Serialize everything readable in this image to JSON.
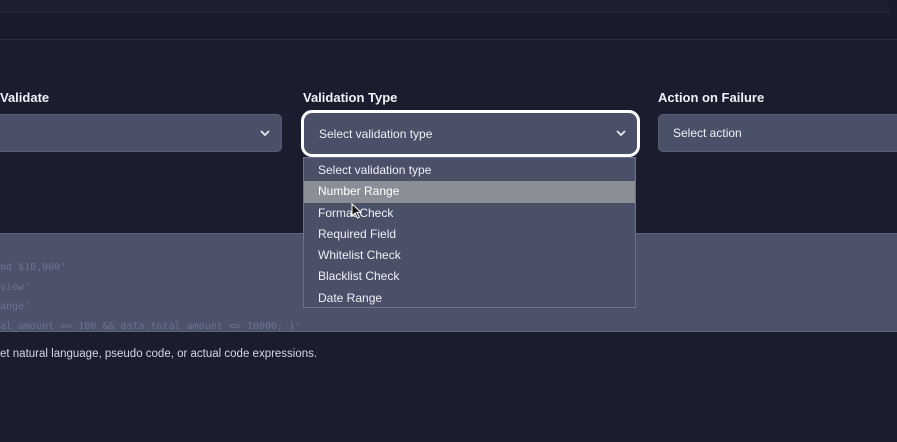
{
  "fields": {
    "field_to_validate": {
      "label": "Validate",
      "value": ""
    },
    "validation_type": {
      "label": "Validation Type",
      "value": "Select validation type"
    },
    "action_on_failure": {
      "label": "Action on Failure",
      "value": "Select action"
    }
  },
  "dropdown": {
    "options": [
      "Select validation type",
      "Number Range",
      "Format Check",
      "Required Field",
      "Whitelist Check",
      "Blacklist Check",
      "Date Range"
    ],
    "hovered": "Number Range"
  },
  "editor": {
    "lines": [
      "nd $10,000'",
      "view'",
      "ange'",
      "al_amount >= 100 && data.total_amount <= 10000; }'"
    ]
  },
  "hint": "et natural language, pseudo code, or actual code expressions.",
  "colors": {
    "background": "#1b1c2d",
    "select_bg": "#4a5068",
    "hover_bg": "#8b8e96",
    "focus_ring": "#ffffff"
  }
}
